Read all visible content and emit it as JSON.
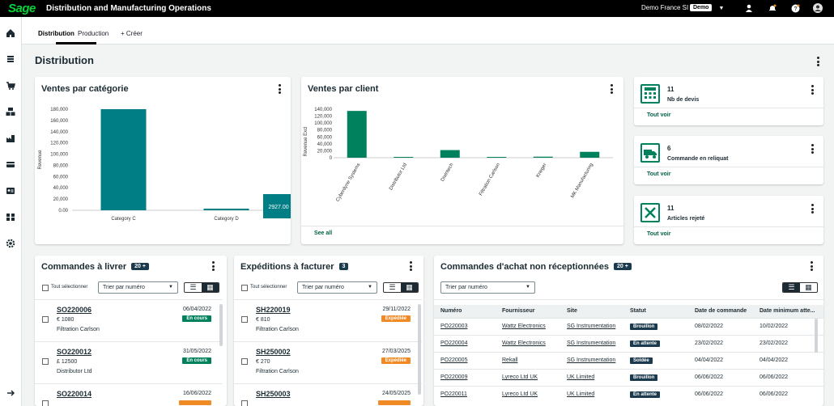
{
  "topbar": {
    "logo": "Sage",
    "title": "Distribution and Manufacturing Operations",
    "tenant": "Demo France SI",
    "badge": "Demo"
  },
  "tabs": [
    {
      "label": "Distribution"
    },
    {
      "label": "Production"
    },
    {
      "label": "+ Créer"
    }
  ],
  "page_title": "Distribution",
  "colors": {
    "teal": "#007e86",
    "green": "#00815d",
    "orange": "#f08a24",
    "navy": "#1c3a4e"
  },
  "cards": {
    "sales_by_category": {
      "title": "Ventes par catégorie",
      "tooltip": "2927.00"
    },
    "sales_by_client": {
      "title": "Ventes par client",
      "link": "See all"
    }
  },
  "kpis": [
    {
      "count": "11",
      "label": "Nb de devis",
      "link": "Tout voir",
      "icon": "calculator-icon"
    },
    {
      "count": "6",
      "label": "Commande en reliquat",
      "link": "Tout voir",
      "icon": "truck-icon"
    },
    {
      "count": "11",
      "label": "Articles rejeté",
      "link": "Tout voir",
      "icon": "rejected-box-icon"
    }
  ],
  "chart_data": [
    {
      "type": "bar",
      "title": "Ventes par catégorie",
      "ylabel": "Revenue",
      "categories": [
        "Category C",
        "Category D"
      ],
      "values": [
        180000,
        2927
      ],
      "yticks": [
        "180,000",
        "160,000",
        "140,000",
        "120,000",
        "100,000",
        "80,000",
        "60,000",
        "40,000",
        "20,000",
        "0.00"
      ],
      "ylim": [
        0,
        180000
      ],
      "color": "#007e86"
    },
    {
      "type": "bar",
      "title": "Ventes par client",
      "ylabel": "Revenue Excl",
      "categories": [
        "Cyberdyne Systems",
        "Distributor Ltd",
        "Distritech",
        "Filtration Carlson",
        "Kneger",
        "MK Manufacturing"
      ],
      "values": [
        135000,
        1000,
        22000,
        1000,
        3000,
        17000
      ],
      "yticks": [
        "140,000",
        "120,000",
        "100,000",
        "80,000",
        "60,000",
        "40,000",
        "20,000",
        "0"
      ],
      "ylim": [
        0,
        140000
      ],
      "color": "#00815d"
    }
  ],
  "orders_to_deliver": {
    "title": "Commandes à livrer",
    "badge": "20 +",
    "select_all": "Tout sélectionner",
    "sort": "Trier par numéro",
    "items": [
      {
        "number": "SO220006",
        "amount": "€ 1080",
        "customer": "Filtration Carlson",
        "date": "06/04/2022",
        "status": "En cours"
      },
      {
        "number": "SO220012",
        "amount": "£ 12500",
        "customer": "Distributor Ltd",
        "date": "31/05/2022",
        "status": "En cours"
      },
      {
        "number": "SO220014",
        "amount": "",
        "customer": "",
        "date": "16/06/2022",
        "status": ""
      }
    ]
  },
  "shipments_to_invoice": {
    "title": "Expéditions à facturer",
    "badge": "3",
    "select_all": "Tout sélectionner",
    "sort": "Trier par numéro",
    "items": [
      {
        "number": "SH220019",
        "amount": "€ 810",
        "customer": "Filtration Carlson",
        "date": "29/11/2022",
        "status": "Expédiée"
      },
      {
        "number": "SH250002",
        "amount": "€ 270",
        "customer": "Filtration Carlson",
        "date": "27/03/2025",
        "status": "Expédiée"
      },
      {
        "number": "SH250003",
        "amount": "",
        "customer": "",
        "date": "24/05/2025",
        "status": ""
      }
    ]
  },
  "purchase_orders": {
    "title": "Commandes d'achat non réceptionnées",
    "badge": "20 +",
    "sort": "Trier par numéro",
    "columns": [
      "Numéro",
      "Fournisseur",
      "Site",
      "Statut",
      "Date de commande",
      "Date minimum atte..."
    ],
    "rows": [
      [
        "PO220003",
        "Wattz Electronics",
        "SG Instrumentation",
        "Brouillon",
        "08/02/2022",
        "10/02/2022"
      ],
      [
        "PO220004",
        "Wattz Electronics",
        "SG Instrumentation",
        "En attente",
        "23/02/2022",
        "23/02/2022"
      ],
      [
        "PO220005",
        "Rekall",
        "SG Instrumentation",
        "Soldée",
        "04/04/2022",
        "04/04/2022"
      ],
      [
        "PO220009",
        "Lyreco Ltd UK",
        "UK Limited",
        "Brouillon",
        "06/06/2022",
        "06/06/2022"
      ],
      [
        "PO220011",
        "Lyreco Ltd UK",
        "UK Limited",
        "En attente",
        "06/06/2022",
        "06/06/2022"
      ]
    ]
  }
}
